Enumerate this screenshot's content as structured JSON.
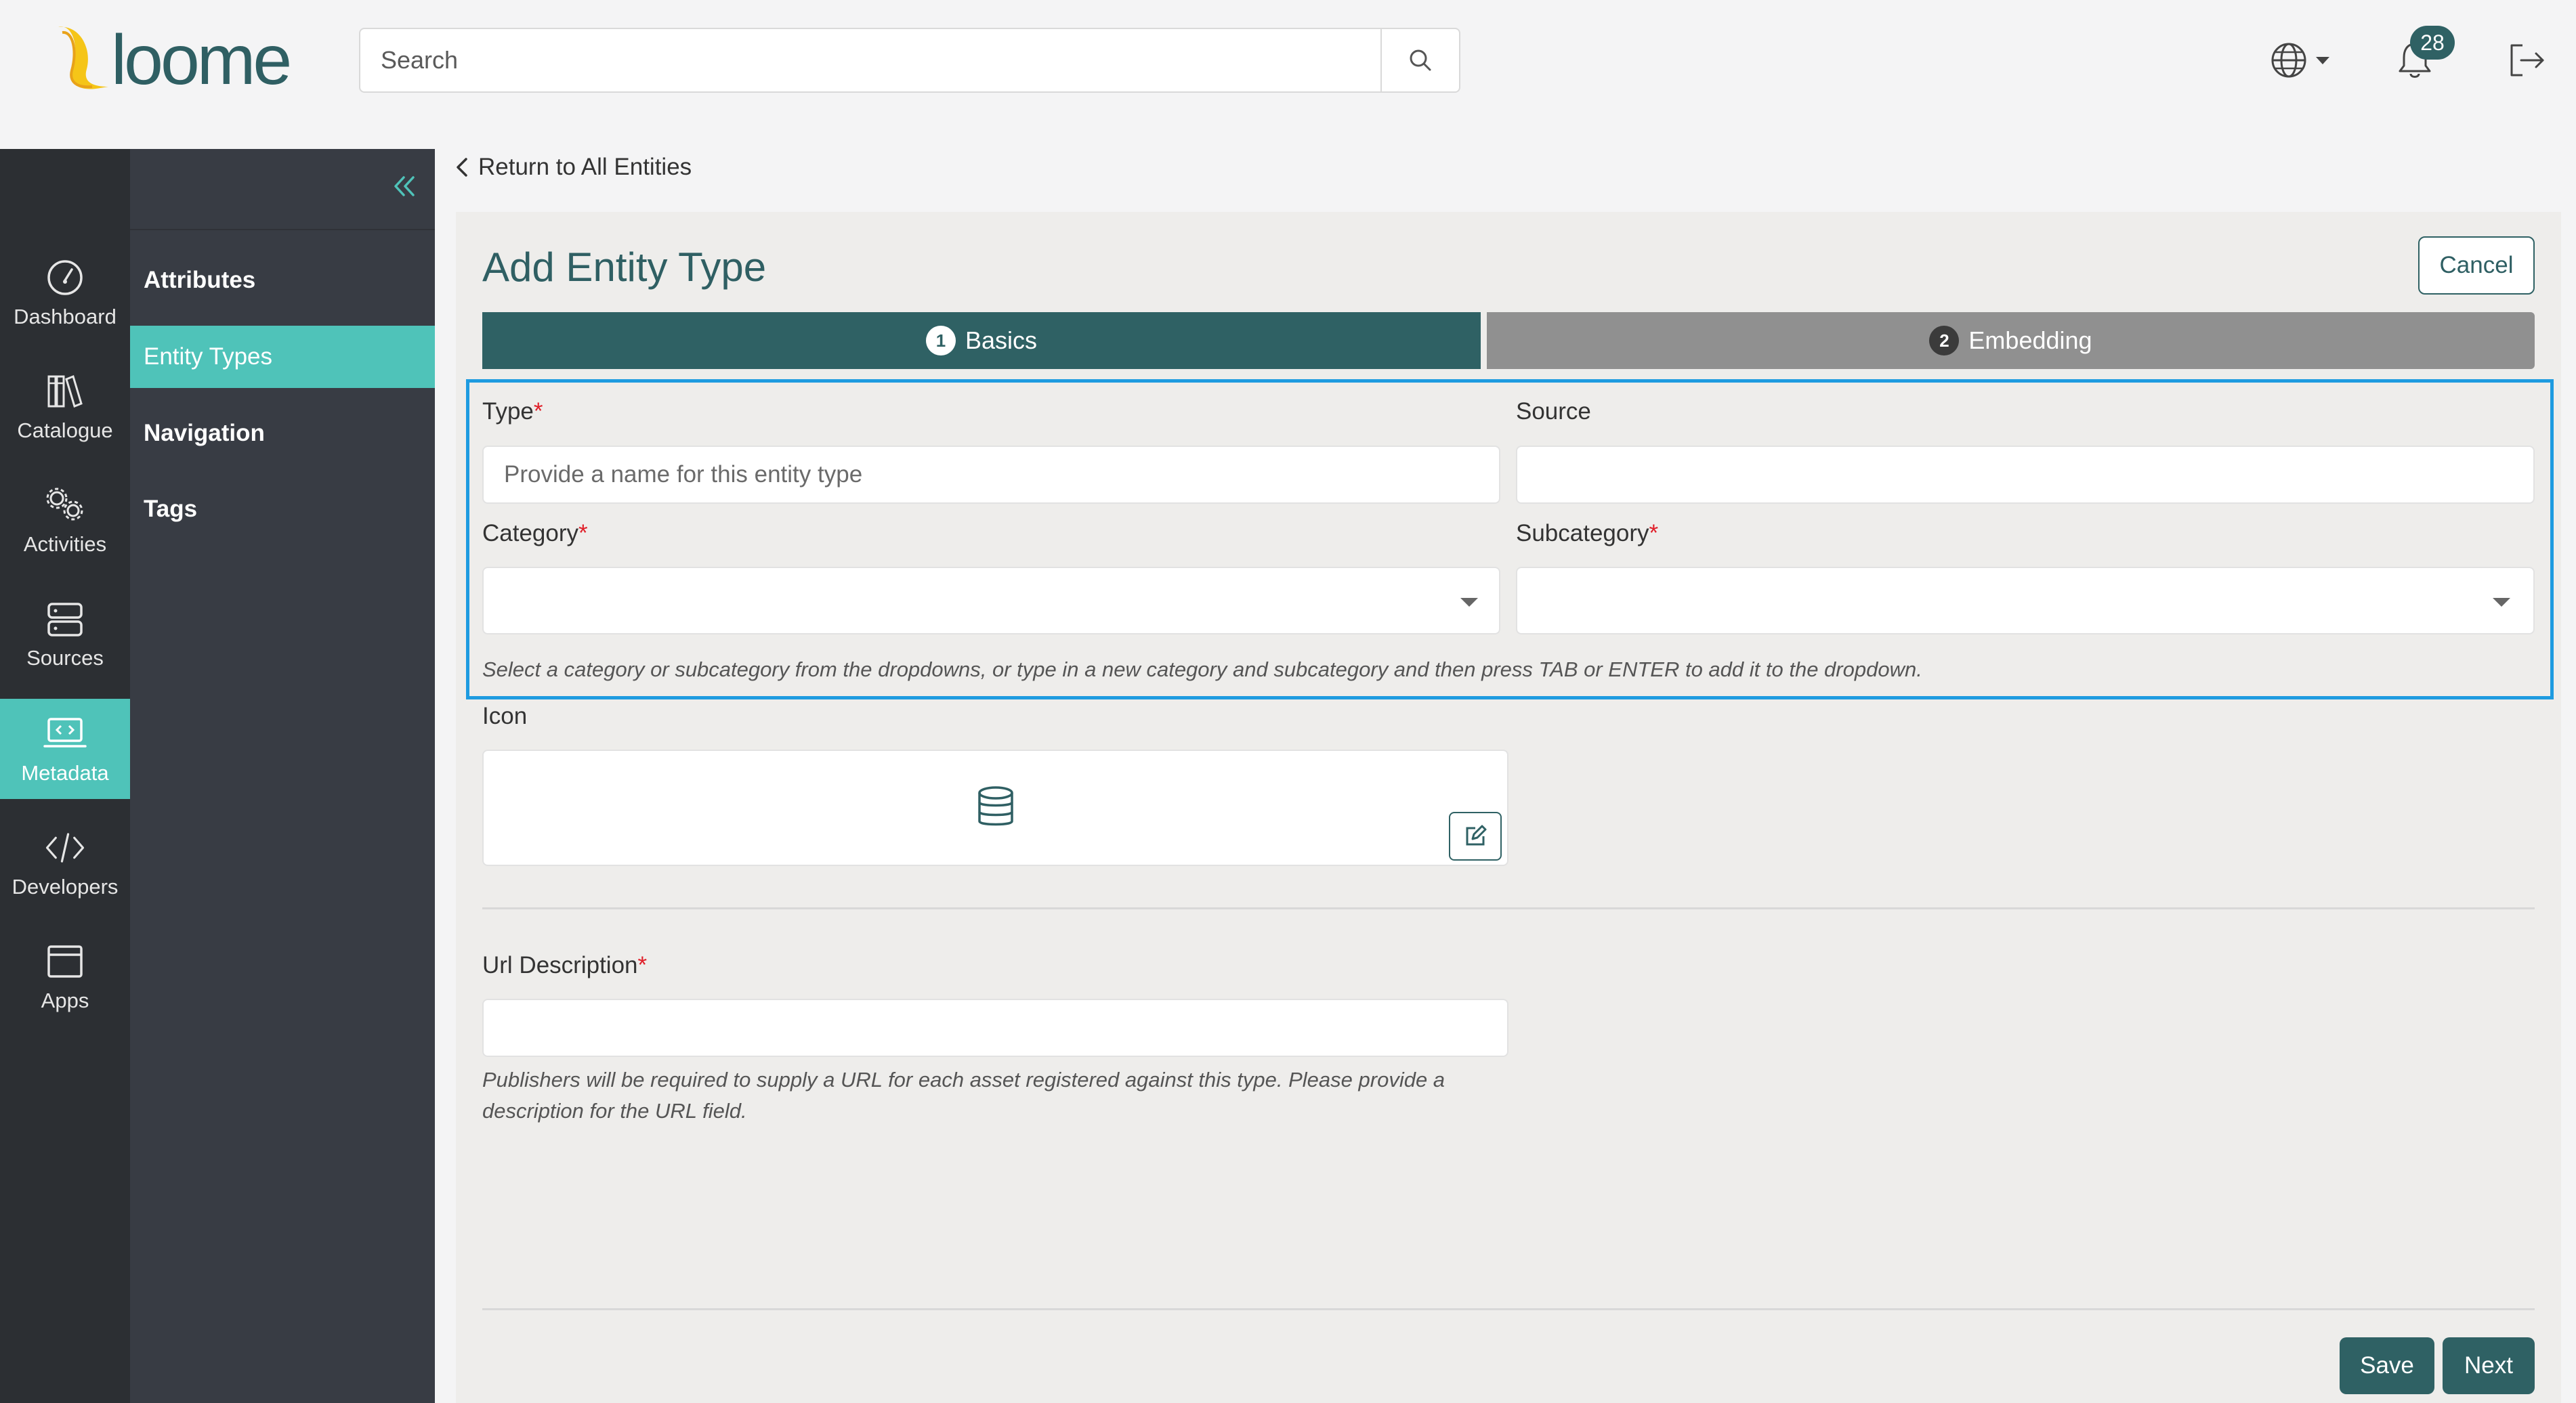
{
  "header": {
    "logo_text": "loome",
    "search": {
      "placeholder": "Search",
      "value": ""
    },
    "notifications_count": "28"
  },
  "rail": {
    "items": [
      {
        "label": "Dashboard",
        "icon": "dashboard-icon"
      },
      {
        "label": "Catalogue",
        "icon": "catalogue-icon"
      },
      {
        "label": "Activities",
        "icon": "activities-icon"
      },
      {
        "label": "Sources",
        "icon": "sources-icon"
      },
      {
        "label": "Metadata",
        "icon": "metadata-icon",
        "active": true
      },
      {
        "label": "Developers",
        "icon": "developers-icon"
      },
      {
        "label": "Apps",
        "icon": "apps-icon"
      }
    ]
  },
  "submenu": {
    "items": [
      {
        "label": "Attributes"
      },
      {
        "label": "Entity Types",
        "active": true
      },
      {
        "label": "Navigation"
      },
      {
        "label": "Tags"
      }
    ]
  },
  "breadcrumb": {
    "return_label": "Return to All Entities"
  },
  "form": {
    "title": "Add Entity Type",
    "cancel_label": "Cancel",
    "steps": [
      {
        "number": "1",
        "label": "Basics",
        "active": true
      },
      {
        "number": "2",
        "label": "Embedding",
        "active": false
      }
    ],
    "type": {
      "label": "Type",
      "required": "*",
      "placeholder": "Provide a name for this entity type",
      "value": ""
    },
    "source": {
      "label": "Source",
      "value": ""
    },
    "category": {
      "label": "Category",
      "required": "*",
      "value": ""
    },
    "subcategory": {
      "label": "Subcategory",
      "required": "*",
      "value": ""
    },
    "category_hint": "Select a category or subcategory from the dropdowns, or type in a new category and subcategory and then press TAB or ENTER to add it to the dropdown.",
    "icon": {
      "label": "Icon",
      "selected_icon": "database-icon"
    },
    "url_description": {
      "label": "Url Description",
      "required": "*",
      "value": "",
      "hint_line1": "Publishers will be required to supply a URL for each asset registered against this type. Please provide a",
      "hint_line2": "description for the URL field."
    },
    "save_label": "Save",
    "next_label": "Next"
  },
  "colors": {
    "accent": "#4fc3b9",
    "primary": "#2f6164",
    "rail_bg": "#2c2f33",
    "submenu_bg": "#383c44",
    "step_inactive": "#909090",
    "highlight": "#1e9be0",
    "required": "#e0202a"
  }
}
